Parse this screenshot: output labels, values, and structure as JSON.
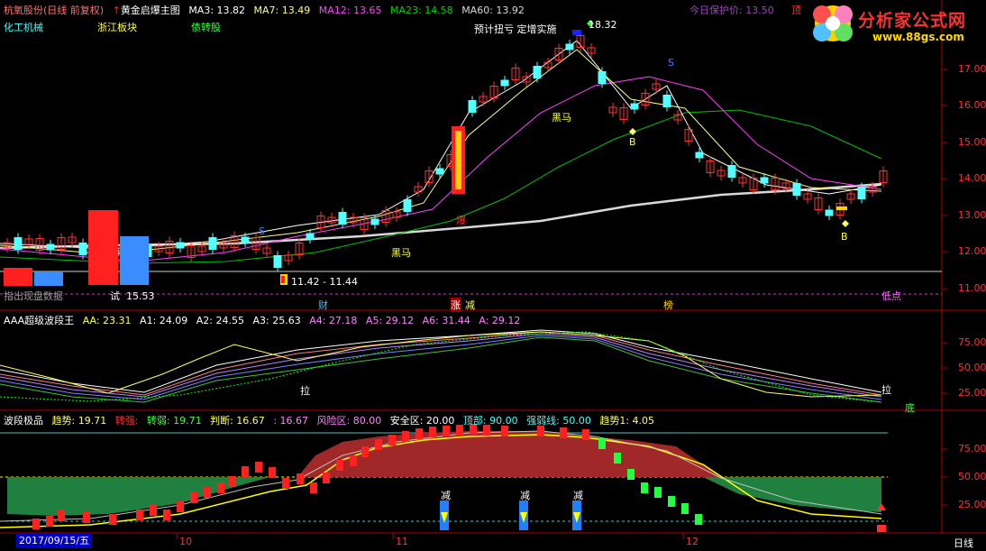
{
  "header": {
    "stock_name": "杭氧股份",
    "period": "(日线 前复权)",
    "indicator": "黄金启爆主图",
    "ma3": "MA3: 13.82",
    "ma7": "MA7: 13.49",
    "ma12": "MA12: 13.65",
    "ma23": "MA23: 14.58",
    "ma60": "MA60: 13.92",
    "protect_price": "今日保护价: 13.50",
    "top_label": "顶"
  },
  "sectors": [
    "化工机械",
    "浙江板块",
    "债转股"
  ],
  "watermark": {
    "title": "分析家公式网",
    "url": "www.88gs.com"
  },
  "main_panel": {
    "y_ticks": [
      "17.00",
      "16.00",
      "15.00",
      "14.00",
      "13.00",
      "12.00",
      "11.00"
    ],
    "high_label": "18.32",
    "range_label": "11.42 - 11.44",
    "forecast_label": "预计扭亏 定增实施",
    "dark_horse_labels": [
      "黑马",
      "黑马"
    ],
    "s_labels": [
      "S",
      "S"
    ],
    "b_labels": [
      "B",
      "B"
    ],
    "burst_label": "爆",
    "markers": [
      "财",
      "涨",
      "减",
      "榜"
    ],
    "low_point": "低点",
    "info_text": "指出现盘数据",
    "small_label": "试",
    "small_value": "15.53",
    "price_line": "11.44"
  },
  "panel2": {
    "title": "AAA超级波段王",
    "values": [
      "AA: 23.31",
      "A1: 24.09",
      "A2: 24.55",
      "A3: 25.63",
      "A4: 27.18",
      "A5: 29.12",
      "A6: 31.44",
      "A: 29.12"
    ],
    "y_ticks": [
      "75.00",
      "50.00",
      "25.00"
    ],
    "pull_labels": [
      "拉",
      "拉"
    ],
    "bottom_label": "底"
  },
  "panel3": {
    "title": "波段极品",
    "trend": "趋势: 19.71",
    "strong": "转强: ",
    "weak": "转弱: 19.71",
    "judge": "判断: 16.67",
    "judge2": ": 16.67",
    "risk": "风险区: 80.00",
    "safe": "安全区: 20.00",
    "top": "顶部: 90.00",
    "strongweak": "强弱线: 50.00",
    "trend1": "趋势1: 4.05",
    "y_ticks": [
      "75.00",
      "50.00",
      "25.00"
    ],
    "reduce_labels": [
      "减",
      "减",
      "减"
    ]
  },
  "x_axis": {
    "date": "2017/09/15/五",
    "months": [
      "10",
      "11",
      "12"
    ],
    "period_label": "日线"
  },
  "colors": {
    "up": "#ff3232",
    "down": "#54ffff",
    "axis": "#b00000",
    "grid": "#800000"
  }
}
